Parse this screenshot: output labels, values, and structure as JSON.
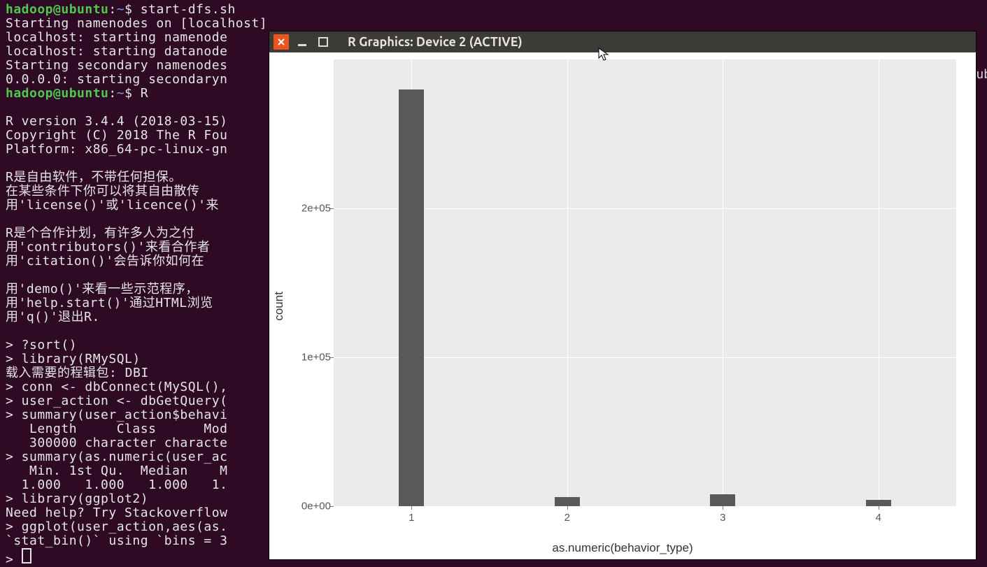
{
  "terminal": {
    "prompt_user_host": "hadoop@ubuntu",
    "prompt_path": "~",
    "lines": [
      {
        "type": "prompt",
        "cmd": "start-dfs.sh"
      },
      {
        "type": "out",
        "text": "Starting namenodes on [localhost]"
      },
      {
        "type": "out",
        "text": "localhost: starting namenode"
      },
      {
        "type": "out",
        "text": "localhost: starting datanode"
      },
      {
        "type": "out",
        "text": "Starting secondary namenodes"
      },
      {
        "type": "out",
        "text": "0.0.0.0: starting secondaryn"
      },
      {
        "type": "prompt",
        "cmd": "R"
      },
      {
        "type": "blank"
      },
      {
        "type": "out",
        "text": "R version 3.4.4 (2018-03-15)"
      },
      {
        "type": "out",
        "text": "Copyright (C) 2018 The R Fou"
      },
      {
        "type": "out",
        "text": "Platform: x86_64-pc-linux-gn"
      },
      {
        "type": "blank"
      },
      {
        "type": "out",
        "text": "R是自由软件，不带任何担保。"
      },
      {
        "type": "out",
        "text": "在某些条件下你可以将其自由散传"
      },
      {
        "type": "out",
        "text": "用'license()'或'licence()'来"
      },
      {
        "type": "blank"
      },
      {
        "type": "out",
        "text": "R是个合作计划，有许多人为之付"
      },
      {
        "type": "out",
        "text": "用'contributors()'来看合作者"
      },
      {
        "type": "out",
        "text": "用'citation()'会告诉你如何在"
      },
      {
        "type": "blank"
      },
      {
        "type": "out",
        "text": "用'demo()'来看一些示范程序，"
      },
      {
        "type": "out",
        "text": "用'help.start()'通过HTML浏览"
      },
      {
        "type": "out",
        "text": "用'q()'退出R."
      },
      {
        "type": "blank"
      },
      {
        "type": "out",
        "text": "> ?sort()"
      },
      {
        "type": "out",
        "text": "> library(RMySQL)"
      },
      {
        "type": "out",
        "text": "载入需要的程辑包: DBI"
      },
      {
        "type": "out",
        "text": "> conn <- dbConnect(MySQL(),"
      },
      {
        "type": "out",
        "text": "> user_action <- dbGetQuery("
      },
      {
        "type": "out",
        "text": "> summary(user_action$behavi"
      },
      {
        "type": "out",
        "text": "   Length     Class      Mod"
      },
      {
        "type": "out",
        "text": "   300000 character characte"
      },
      {
        "type": "out",
        "text": "> summary(as.numeric(user_ac"
      },
      {
        "type": "out",
        "text": "   Min. 1st Qu.  Median    M"
      },
      {
        "type": "out",
        "text": "  1.000   1.000   1.000   1."
      },
      {
        "type": "out",
        "text": "> library(ggplot2)"
      },
      {
        "type": "out",
        "text": "Need help? Try Stackoverflow"
      },
      {
        "type": "out",
        "text": "> ggplot(user_action,aes(as."
      },
      {
        "type": "out",
        "text": "`stat_bin()` using `bins = 3"
      },
      {
        "type": "rprompt"
      }
    ],
    "edge_text": "-ub"
  },
  "window": {
    "title": "R Graphics: Device 2 (ACTIVE)",
    "close_icon": "close-icon",
    "minimize_icon": "minimize-icon",
    "maximize_icon": "maximize-icon"
  },
  "chart_data": {
    "type": "bar",
    "categories": [
      1,
      2,
      3,
      4
    ],
    "values": [
      280000,
      6000,
      8000,
      4000
    ],
    "xlabel": "as.numeric(behavior_type)",
    "ylabel": "count",
    "ylim": [
      0,
      300000
    ],
    "y_ticks": [
      {
        "value": 0,
        "label": "0e+00"
      },
      {
        "value": 100000,
        "label": "1e+05"
      },
      {
        "value": 200000,
        "label": "2e+05"
      }
    ],
    "x_ticks": [
      "1",
      "2",
      "3",
      "4"
    ]
  }
}
